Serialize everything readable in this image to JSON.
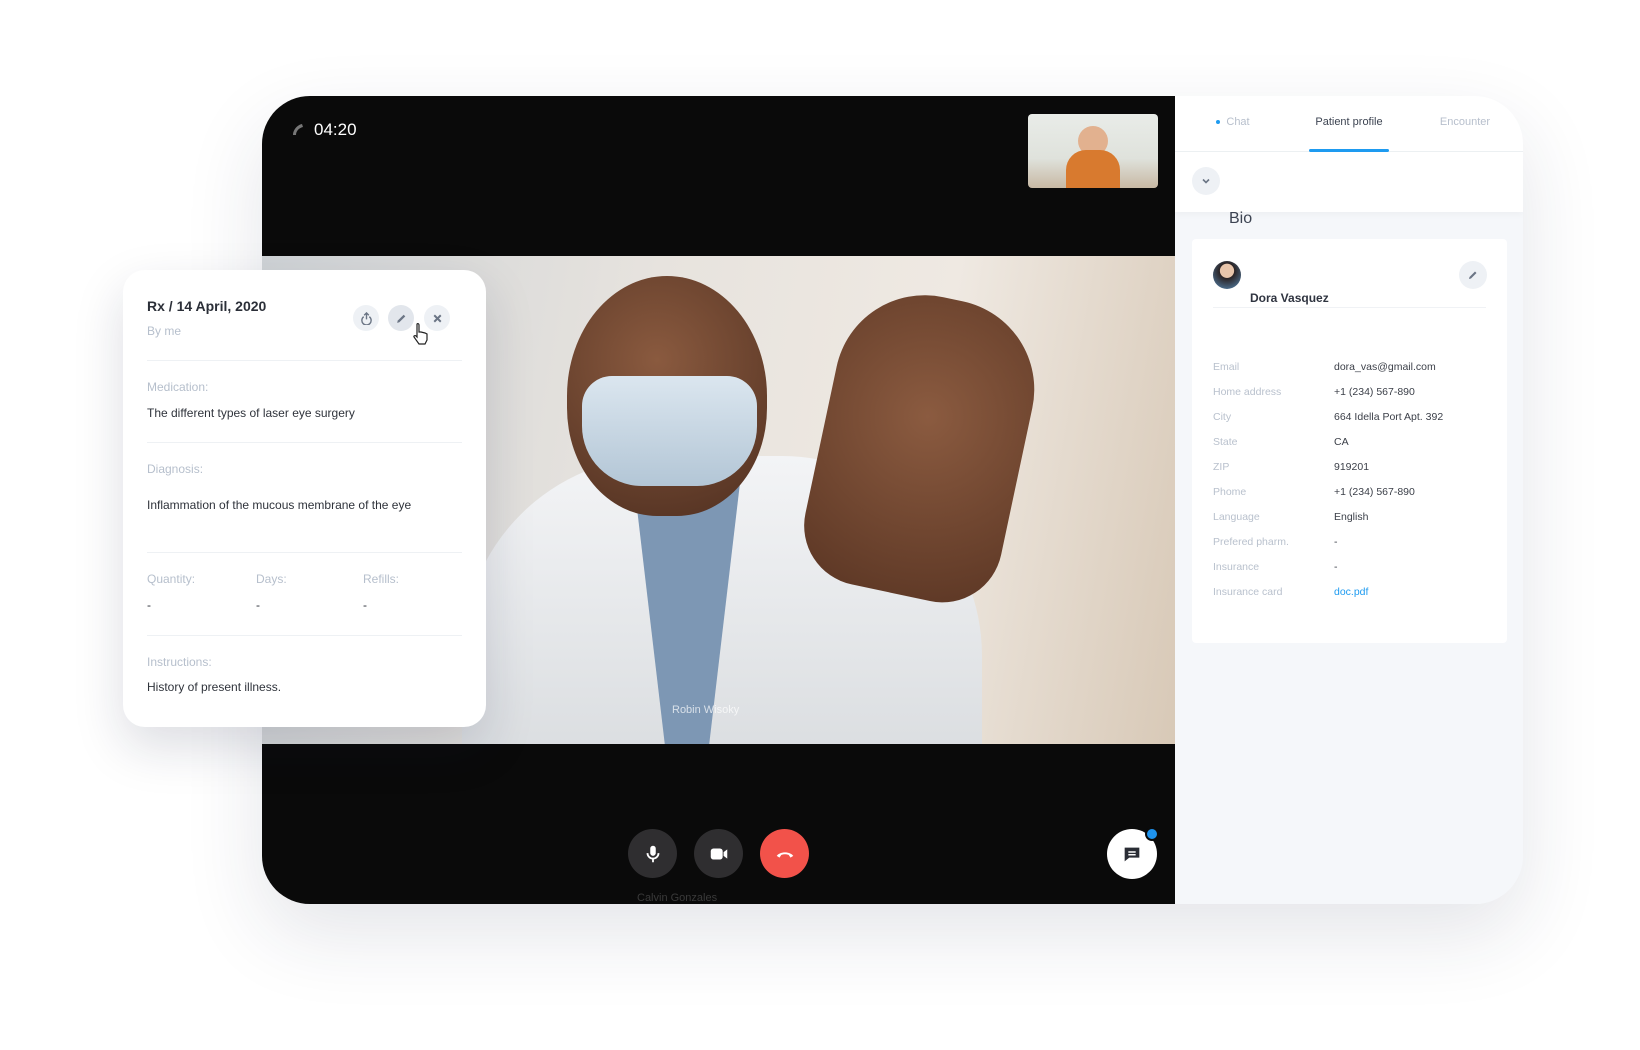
{
  "call": {
    "timer": "04:20",
    "remote_name": "Robin Wisoky",
    "local_name": "Calvin Gonzales",
    "controls": [
      {
        "icon": "microphone-icon"
      },
      {
        "icon": "video-camera-icon"
      },
      {
        "icon": "hang-up-icon"
      }
    ],
    "end_call_color": "#f2524a",
    "accent": "#1e9bf0"
  },
  "panel": {
    "tabs": [
      {
        "label": "Chat",
        "unread": true
      },
      {
        "label": "Patient profile",
        "active": true
      },
      {
        "label": "Encounter"
      }
    ],
    "bio_title": "Bio",
    "patient_name": "Dora Vasquez",
    "fields": [
      {
        "label": "Email",
        "value": "dora_vas@gmail.com"
      },
      {
        "label": "Home address",
        "value": "+1 (234) 567-890"
      },
      {
        "label": "City",
        "value": "664 Idella Port Apt. 392"
      },
      {
        "label": "State",
        "value": "CA"
      },
      {
        "label": "ZIP",
        "value": "919201"
      },
      {
        "label": "Phome",
        "value": "+1 (234) 567-890"
      },
      {
        "label": "Language",
        "value": "English"
      },
      {
        "label": "Prefered pharm.",
        "value": "-"
      },
      {
        "label": "Insurance",
        "value": "-"
      },
      {
        "label": "Insurance card",
        "value": "doc.pdf"
      }
    ]
  },
  "rx": {
    "title": "Rx / 14 April, 2020",
    "author": "By me",
    "medication_label": "Medication:",
    "medication": "The different types of laser eye surgery",
    "diagnosis_label": "Diagnosis:",
    "diagnosis": "Inflammation of the mucous membrane of the eye",
    "quantity_label": "Quantity:",
    "quantity": "-",
    "days_label": "Days:",
    "days": "-",
    "refills_label": "Refills:",
    "refills": "-",
    "instructions_label": "Instructions:",
    "instructions": "History of present illness."
  }
}
